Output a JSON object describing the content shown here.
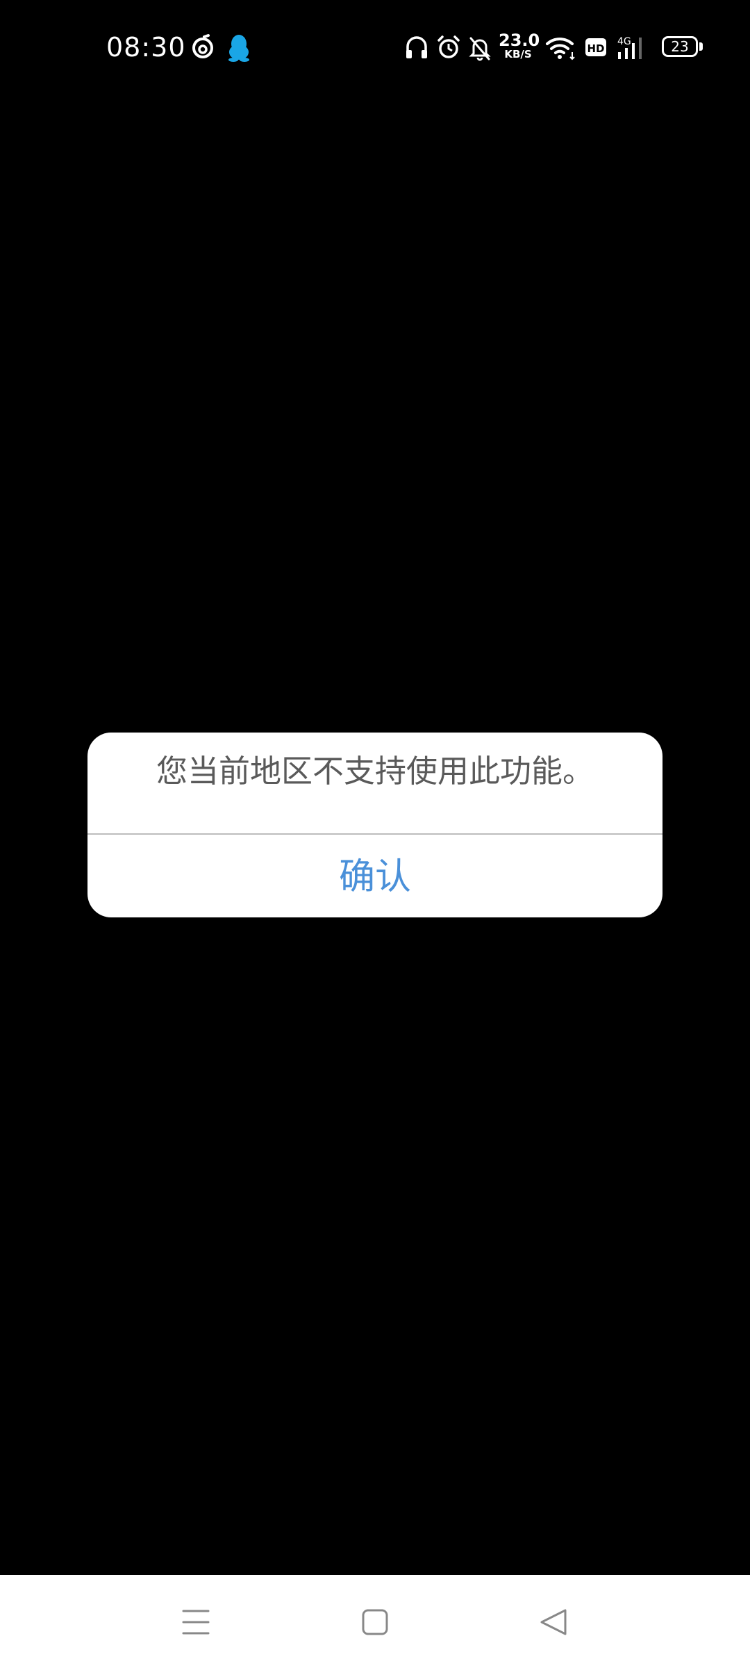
{
  "status_bar": {
    "time": "08:30",
    "net_speed_value": "23.0",
    "net_speed_unit": "KB/S",
    "hd_label": "HD",
    "network_type": "4G",
    "battery_level": "23",
    "icons": [
      "netease-music-icon",
      "qq-icon",
      "headphones-icon",
      "alarm-icon",
      "bell-off-icon",
      "wifi-icon",
      "hd-icon",
      "cellular-signal-icon",
      "battery-icon"
    ],
    "qq_color": "#1aa6e6"
  },
  "dialog": {
    "message": "您当前地区不支持使用此功能。",
    "confirm_label": "确认",
    "confirm_color": "#4a90d9"
  },
  "nav_bar": {
    "buttons": [
      "menu-icon",
      "home-icon",
      "back-icon"
    ]
  }
}
